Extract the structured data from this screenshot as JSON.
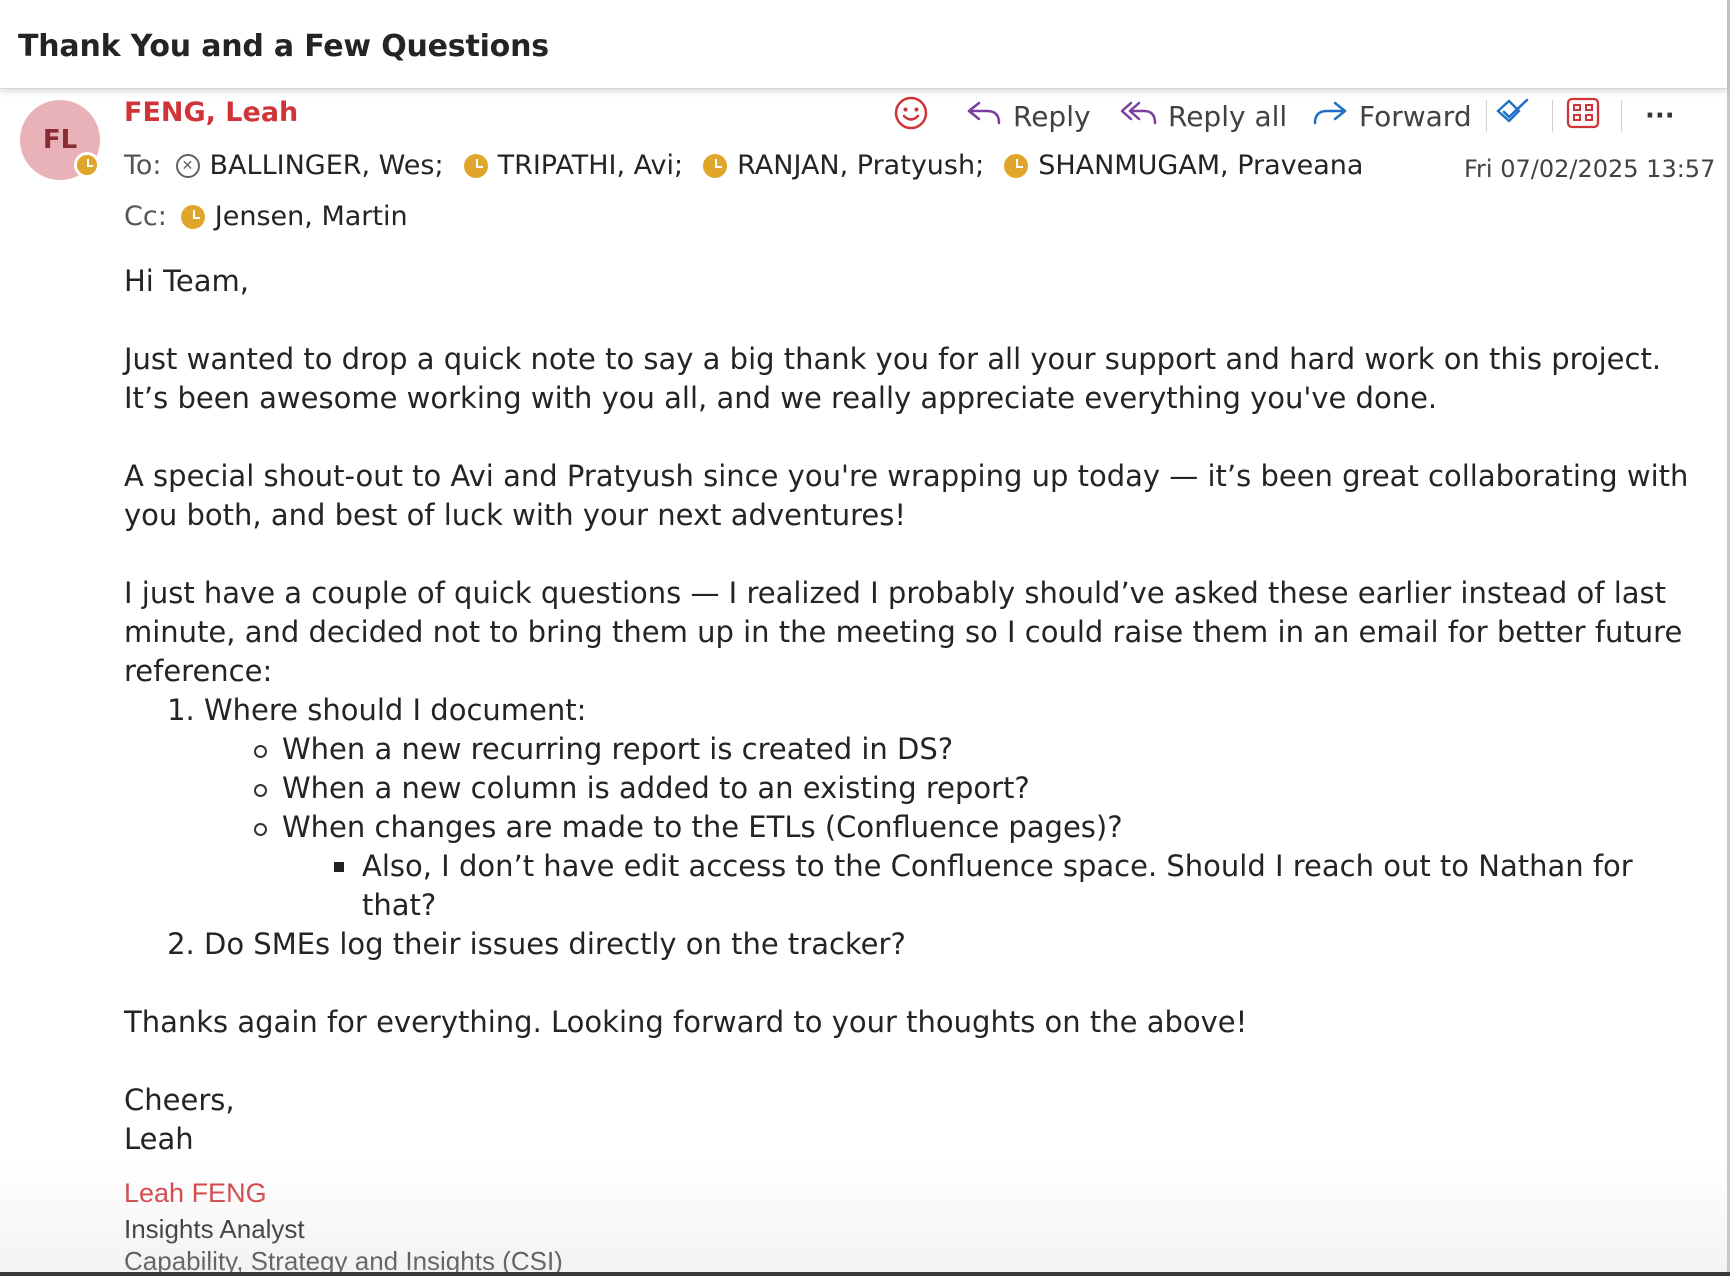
{
  "email": {
    "subject": "Thank You and a Few Questions",
    "sender_initials": "FL",
    "sender_name": "FENG, Leah",
    "to_label": "To:",
    "to": [
      "BALLINGER, Wes;",
      "TRIPATHI, Avi;",
      "RANJAN, Pratyush;",
      "SHANMUGAM, Praveana"
    ],
    "cc_label": "Cc:",
    "cc": [
      "Jensen, Martin"
    ],
    "date": "Fri 07/02/2025 13:57"
  },
  "actions": {
    "reply": "Reply",
    "reply_all": "Reply all",
    "forward": "Forward",
    "more": "···"
  },
  "body": {
    "greeting": "Hi Team,",
    "p1": "Just wanted to drop a quick note to say a big thank you for all your support and hard work on this project. It’s been awesome working with you all, and we really appreciate everything you've done.",
    "p2": "A special shout-out to Avi and Pratyush since you're wrapping up today — it’s been great collaborating with you both, and best of luck with your next adventures!",
    "p3": "I just have a couple of quick questions — I realized I probably should’ve asked these earlier instead of last minute, and decided not to bring them up in the meeting so I could raise them in an email for better future reference:",
    "q1": "Where should I document:",
    "q1_subs": [
      "When a new recurring report is created in DS?",
      "When a new column is added to an existing report?",
      "When changes are made to the ETLs (Confluence pages)?"
    ],
    "q1_sub3_detail": "Also, I don’t have edit access to the Confluence space. Should I reach out to Nathan for that?",
    "q2": "Do SMEs log their issues directly on the tracker?",
    "p4": "Thanks again for everything. Looking forward to your thoughts on the above!",
    "closing": "Cheers,",
    "closing_name": "Leah"
  },
  "signature": {
    "name": "Leah FENG",
    "title": "Insights Analyst",
    "department": "Capability, Strategy and Insights (CSI)"
  },
  "colors": {
    "sender_red": "#d13438",
    "presence_away": "#e0a52b",
    "avatar_bg": "#e8b2b8",
    "reply_purple": "#7a3e9d",
    "forward_blue": "#1f6fc5"
  }
}
